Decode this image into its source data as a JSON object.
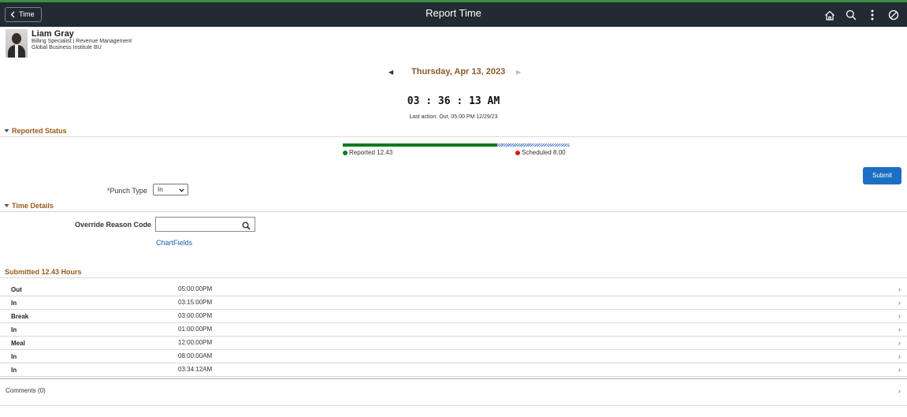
{
  "header": {
    "back_label": "Time",
    "title": "Report Time",
    "icons": [
      "home-icon",
      "search-icon",
      "more-vertical-icon",
      "navbar-icon"
    ]
  },
  "employee": {
    "name": "Liam Gray",
    "title_line": "Billing Specialist | Revenue Management",
    "bu_line": "Global Business Institute BU"
  },
  "date_nav": {
    "date": "Thursday, Apr 13, 2023"
  },
  "clock": {
    "time": "03 : 36 : 13 AM",
    "last_action": "Last action: Out, 05.00 PM 12/29/23"
  },
  "reported_status": {
    "section_title": "Reported Status",
    "reported_label": "Reported 12.43",
    "scheduled_label": "Scheduled 8.00",
    "reported_hours": 12.43,
    "scheduled_hours": 8.0,
    "reported_color": "#0b7a20",
    "scheduled_color": "#e0161b"
  },
  "actions": {
    "submit_label": "Submit"
  },
  "punch": {
    "label": "*Punch Type",
    "selected": "In"
  },
  "time_details": {
    "section_title": "Time Details",
    "override_label": "Override Reason Code",
    "override_value": "",
    "chartfields_link": "ChartFields"
  },
  "submitted": {
    "title": "Submitted 12.43 Hours",
    "rows": [
      {
        "type": "Out",
        "time": "05:00:00PM"
      },
      {
        "type": "In",
        "time": "03:15:00PM"
      },
      {
        "type": "Break",
        "time": "03:00:00PM"
      },
      {
        "type": "In",
        "time": "01:00:00PM"
      },
      {
        "type": "Meal",
        "time": "12:00:00PM"
      },
      {
        "type": "In",
        "time": "08:00:00AM"
      },
      {
        "type": "In",
        "time": "03:34:12AM"
      }
    ]
  },
  "comments": {
    "label": "Comments (0)"
  }
}
